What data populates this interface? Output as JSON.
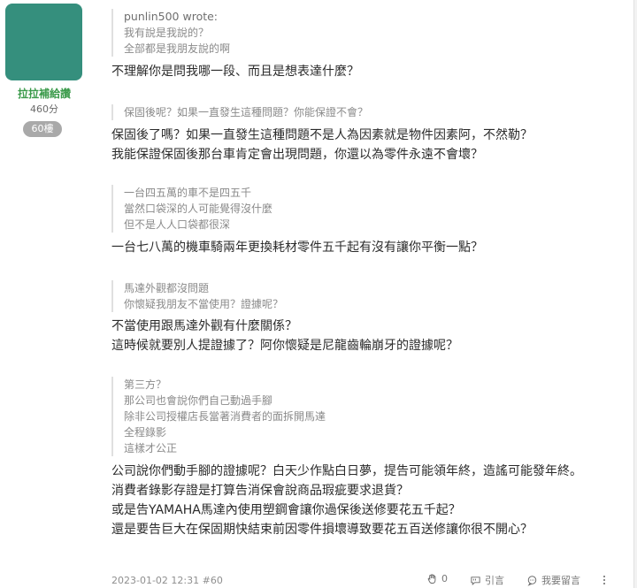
{
  "author": {
    "name": "拉拉補給讚",
    "score": "460分",
    "floor_badge": "60樓"
  },
  "quotes": [
    {
      "author": "punlin500 wrote:",
      "lines": [
        "我有說是我說的？",
        "全部都是我朋友說的啊"
      ]
    },
    {
      "lines": [
        "保固後呢？如果一直發生這種問題？你能保證不會？"
      ]
    },
    {
      "lines": [
        "一台四五萬的車不是四五千",
        "當然口袋深的人可能覺得沒什麼",
        "但不是人人口袋都很深"
      ]
    },
    {
      "lines": [
        "馬達外觀都沒問題",
        "你懷疑我朋友不當使用？證據呢？"
      ]
    },
    {
      "lines": [
        "第三方？",
        "那公司也會說你們自己動過手腳",
        "除非公司授權店長當著消費者的面拆開馬達",
        "全程錄影",
        "這樣才公正"
      ]
    }
  ],
  "replies": [
    {
      "lines": [
        "不理解你是問我哪一段、而且是想表達什麼？"
      ]
    },
    {
      "lines": [
        "保固後了嗎？如果一直發生這種問題不是人為因素就是物件因素阿，不然勒？",
        "我能保證保固後那台車肯定會出現問題，你還以為零件永遠不會壞？"
      ]
    },
    {
      "lines": [
        "一台七八萬的機車騎兩年更換耗材零件五千起有沒有讓你平衡一點？"
      ]
    },
    {
      "lines": [
        "不當使用跟馬達外觀有什麼關係？",
        "這時候就要別人提證據了？阿你懷疑是尼龍齒輪崩牙的證據呢？"
      ]
    },
    {
      "lines": [
        "公司說你們動手腳的證據呢？白天少作點白日夢，提告可能領年終，造謠可能發年終。",
        "消費者錄影存證是打算告消保會說商品瑕疵要求退貨？",
        "或是告YAMAHA馬達內使用塑鋼會讓你過保後送修要花五千起？",
        "還是要告巨大在保固期快結束前因零件損壞導致要花五百送修讓你很不開心？"
      ]
    }
  ],
  "footer": {
    "timestamp": "2023-01-02 12:31 #60",
    "like_count": "0",
    "quote_label": "引言",
    "reply_label": "我要留言"
  },
  "icons": {
    "like": "clap-icon",
    "quote": "quote-bubble-icon",
    "reply": "reply-bubble-icon",
    "more": "more-vertical-icon"
  },
  "colors": {
    "avatar": "#358f7d",
    "author_name": "#3a9a4a",
    "badge": "#a9a9a9"
  }
}
